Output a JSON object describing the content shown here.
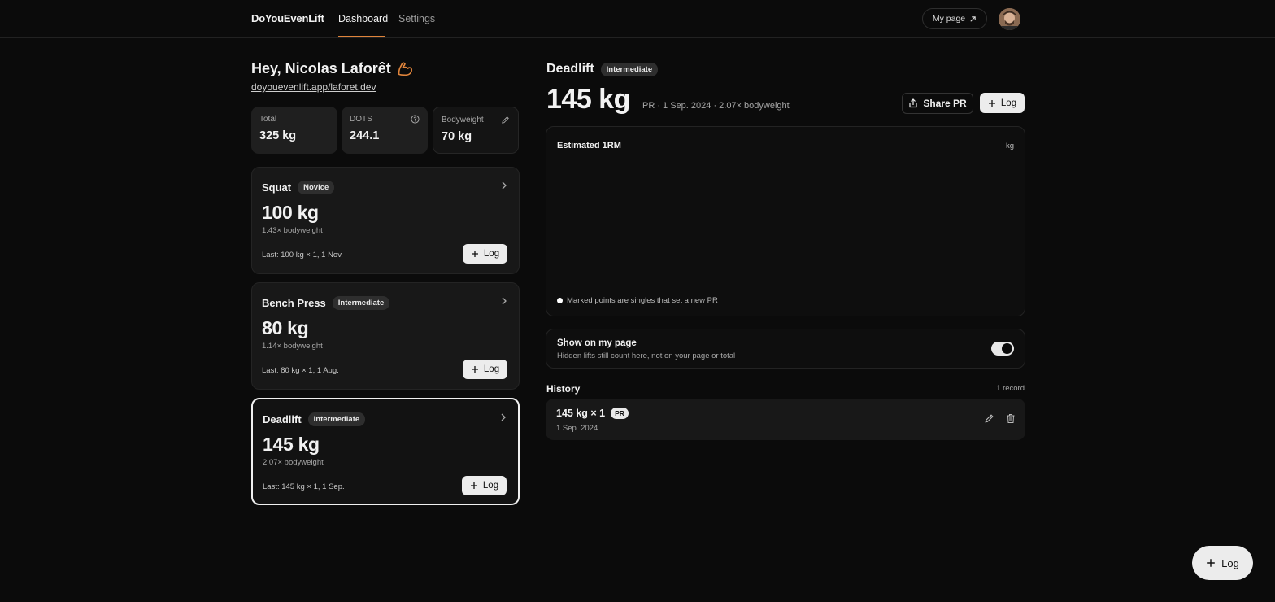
{
  "nav": {
    "brand": "DoYouEvenLift",
    "tabs": [
      "Dashboard",
      "Settings"
    ],
    "my_page": "My page"
  },
  "profile": {
    "greeting": "Hey, Nicolas Laforêt",
    "url": "doyouevenlift.app/laforet.dev"
  },
  "stats": [
    {
      "label": "Total",
      "value": "325 kg"
    },
    {
      "label": "DOTS",
      "value": "244.1",
      "icon": "help-circle-icon"
    },
    {
      "label": "Bodyweight",
      "value": "70 kg",
      "icon": "pencil-icon"
    }
  ],
  "lifts": [
    {
      "name": "Squat",
      "level": "Novice",
      "weight": "100 kg",
      "bw": "1.43× bodyweight",
      "last": "Last: 100 kg × 1, 1 Nov.",
      "log": "Log"
    },
    {
      "name": "Bench Press",
      "level": "Intermediate",
      "weight": "80 kg",
      "bw": "1.14× bodyweight",
      "last": "Last: 80 kg × 1, 1 Aug.",
      "log": "Log"
    },
    {
      "name": "Deadlift",
      "level": "Intermediate",
      "weight": "145 kg",
      "bw": "2.07× bodyweight",
      "last": "Last: 145 kg × 1, 1 Sep.",
      "log": "Log"
    }
  ],
  "detail": {
    "name": "Deadlift",
    "level": "Intermediate",
    "weight": "145 kg",
    "meta": "PR · 1 Sep. 2024 · 2.07× bodyweight",
    "share": "Share PR",
    "log": "Log",
    "chart_title": "Estimated 1RM",
    "chart_unit": "kg",
    "chart_legend": "Marked points are singles that set a new PR",
    "toggle_title": "Show on my page",
    "toggle_sub": "Hidden lifts still count here, not on your page or total",
    "toggle_on": true,
    "history_label": "History",
    "history_count": "1 record",
    "history": [
      {
        "entry": "145 kg × 1",
        "badge": "PR",
        "date": "1 Sep. 2024"
      }
    ]
  },
  "fab": {
    "label": "Log"
  },
  "colors": {
    "accent": "#e0843b",
    "background": "#0b0b0b",
    "card": "#181818"
  }
}
